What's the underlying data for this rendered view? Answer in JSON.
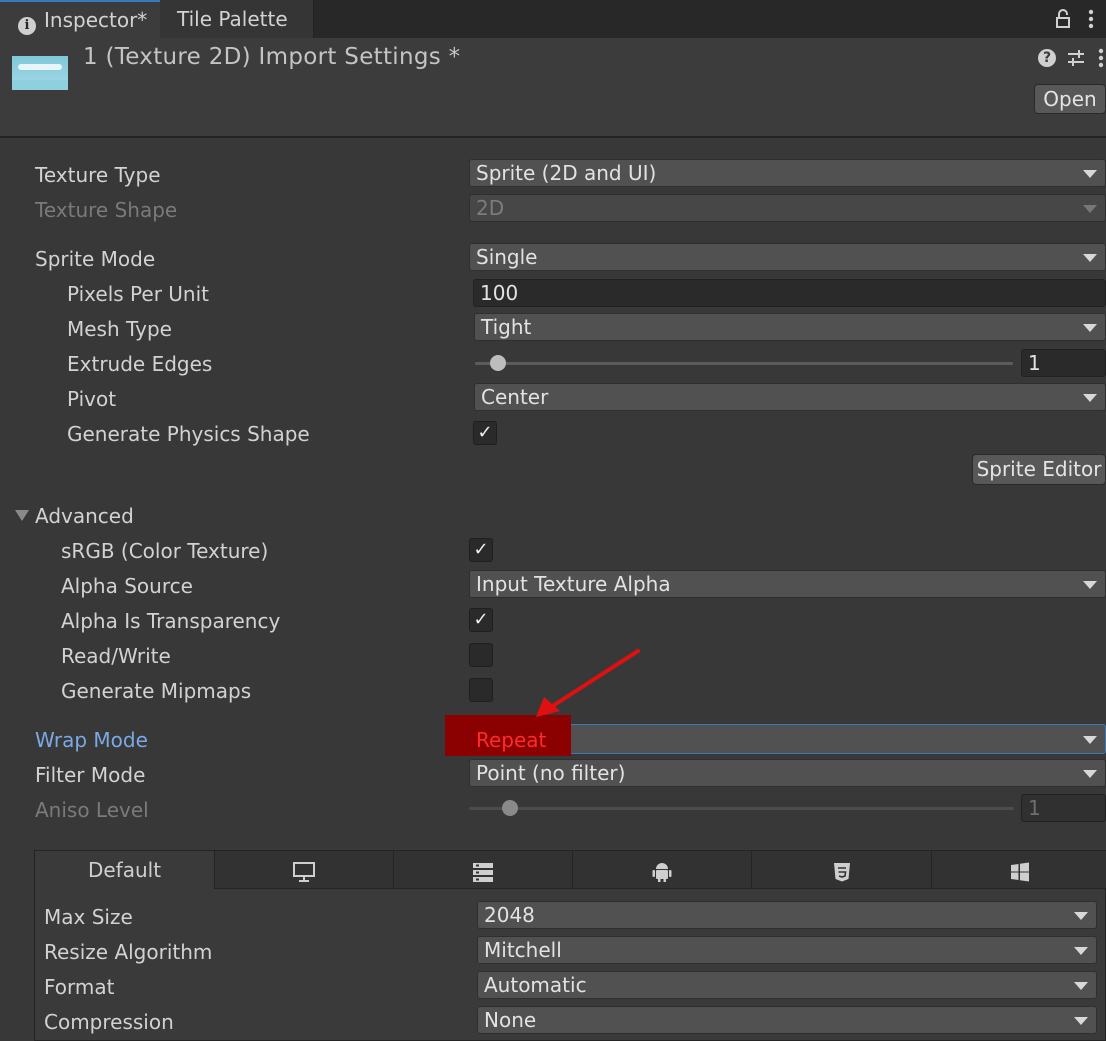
{
  "tabs": {
    "inspector": "Inspector*",
    "tile_palette": "Tile Palette"
  },
  "header": {
    "title": "1 (Texture 2D) Import Settings *",
    "open_label": "Open"
  },
  "fields": {
    "texture_type": {
      "label": "Texture Type",
      "value": "Sprite (2D and UI)"
    },
    "texture_shape": {
      "label": "Texture Shape",
      "value": "2D"
    },
    "sprite_mode": {
      "label": "Sprite Mode",
      "value": "Single"
    },
    "pixels_per_unit": {
      "label": "Pixels Per Unit",
      "value": "100"
    },
    "mesh_type": {
      "label": "Mesh Type",
      "value": "Tight"
    },
    "extrude_edges": {
      "label": "Extrude Edges",
      "value": "1"
    },
    "pivot": {
      "label": "Pivot",
      "value": "Center"
    },
    "generate_physics_shape": {
      "label": "Generate Physics Shape",
      "checked": true
    },
    "sprite_editor_label": "Sprite Editor"
  },
  "advanced": {
    "label": "Advanced",
    "srgb": {
      "label": "sRGB (Color Texture)",
      "checked": true
    },
    "alpha_source": {
      "label": "Alpha Source",
      "value": "Input Texture Alpha"
    },
    "alpha_is_transparency": {
      "label": "Alpha Is Transparency",
      "checked": true
    },
    "read_write": {
      "label": "Read/Write",
      "checked": false
    },
    "generate_mipmaps": {
      "label": "Generate Mipmaps",
      "checked": false
    }
  },
  "wrap_mode": {
    "label": "Wrap Mode",
    "value": "Repeat"
  },
  "filter_mode": {
    "label": "Filter Mode",
    "value": "Point (no filter)"
  },
  "aniso_level": {
    "label": "Aniso Level",
    "value": "1"
  },
  "platform_tabs": {
    "default_label": "Default",
    "icons": [
      "monitor-icon",
      "server-icon",
      "android-icon",
      "html5-icon",
      "windows-icon"
    ]
  },
  "platform_settings": {
    "max_size": {
      "label": "Max Size",
      "value": "2048"
    },
    "resize_algorithm": {
      "label": "Resize Algorithm",
      "value": "Mitchell"
    },
    "format": {
      "label": "Format",
      "value": "Automatic"
    },
    "compression": {
      "label": "Compression",
      "value": "None"
    }
  },
  "colors": {
    "background": "#383838",
    "accent": "#3a79bb",
    "highlight": "#8b0000",
    "annotation_arrow": "#e01010",
    "wrap_value_text": "#ff2a2a"
  }
}
